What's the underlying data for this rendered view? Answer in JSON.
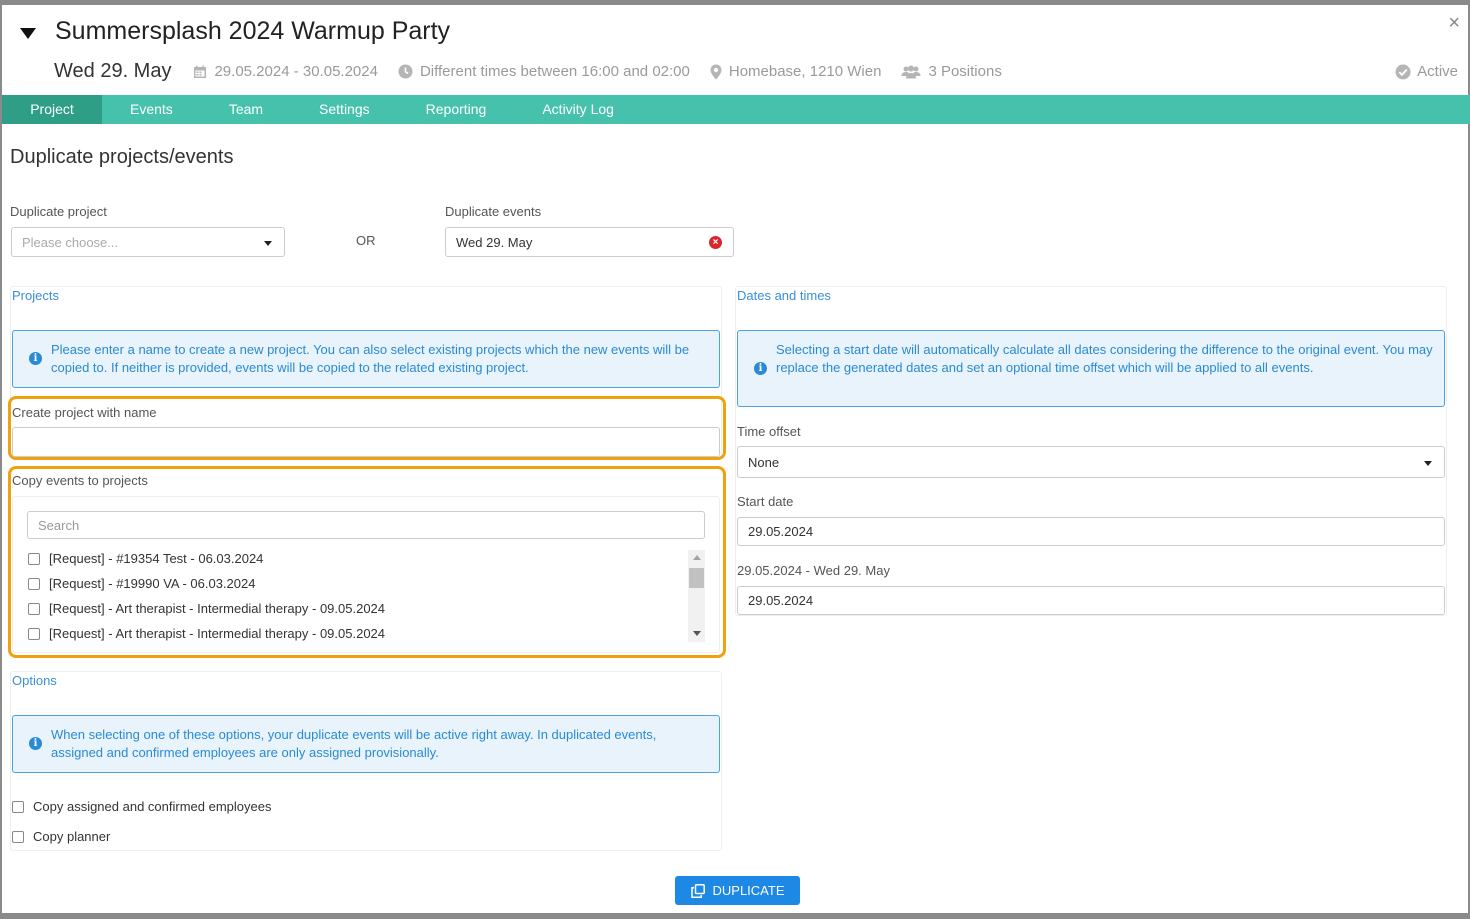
{
  "header": {
    "title": "Summersplash 2024 Warmup Party",
    "date": "Wed 29. May",
    "date_range": "29.05.2024 - 30.05.2024",
    "times": "Different times between 16:00 and 02:00",
    "location": "Homebase, 1210 Wien",
    "positions": "3 Positions",
    "status": "Active",
    "close": "×"
  },
  "tabs": [
    "Project",
    "Events",
    "Team",
    "Settings",
    "Reporting",
    "Activity Log"
  ],
  "page_title": "Duplicate projects/events",
  "duplicate_project": {
    "label": "Duplicate project",
    "placeholder": "Please choose..."
  },
  "or_text": "OR",
  "duplicate_events": {
    "label": "Duplicate events",
    "value": "Wed 29. May"
  },
  "projects": {
    "title": "Projects",
    "info": "Please enter a name to create a new project. You can also select existing projects which the new events will be copied to. If neither is provided, events will be copied to the related existing project.",
    "create_label": "Create project with name",
    "create_value": "",
    "copy_label": "Copy events to projects",
    "search_placeholder": "Search",
    "list": [
      "[Request] - #19354 Test - 06.03.2024",
      "[Request] - #19990 VA - 06.03.2024",
      "[Request] - Art therapist - Intermedial therapy - 09.05.2024",
      "[Request] - Art therapist - Intermedial therapy - 09.05.2024"
    ]
  },
  "options": {
    "title": "Options",
    "info": "When selecting one of these options, your duplicate events will be active right away. In duplicated events, assigned and confirmed employees are only assigned provisionally.",
    "items": [
      "Copy assigned and confirmed employees",
      "Copy planner"
    ]
  },
  "dates": {
    "title": "Dates and times",
    "info": "Selecting a start date will automatically calculate all dates considering the difference to the original event. You may replace the generated dates and set an optional time offset which will be applied to all events.",
    "time_offset_label": "Time offset",
    "time_offset_value": "None",
    "start_date_label": "Start date",
    "start_date_value": "29.05.2024",
    "event_label": "29.05.2024 - Wed 29. May",
    "event_value": "29.05.2024"
  },
  "button": {
    "duplicate": "DUPLICATE"
  },
  "icons": {
    "calendar": "calendar-icon",
    "clock": "clock-icon",
    "pin": "map-pin-icon",
    "users": "users-icon",
    "check": "check-circle-icon",
    "copy": "copy-icon"
  },
  "colors": {
    "tabbar": "#46c2ac",
    "tab_active": "#2e9e87",
    "accent_blue": "#1e88e5",
    "info_blue": "#2a8ad3",
    "highlight": "#f0a10e",
    "danger": "#d9262c"
  }
}
